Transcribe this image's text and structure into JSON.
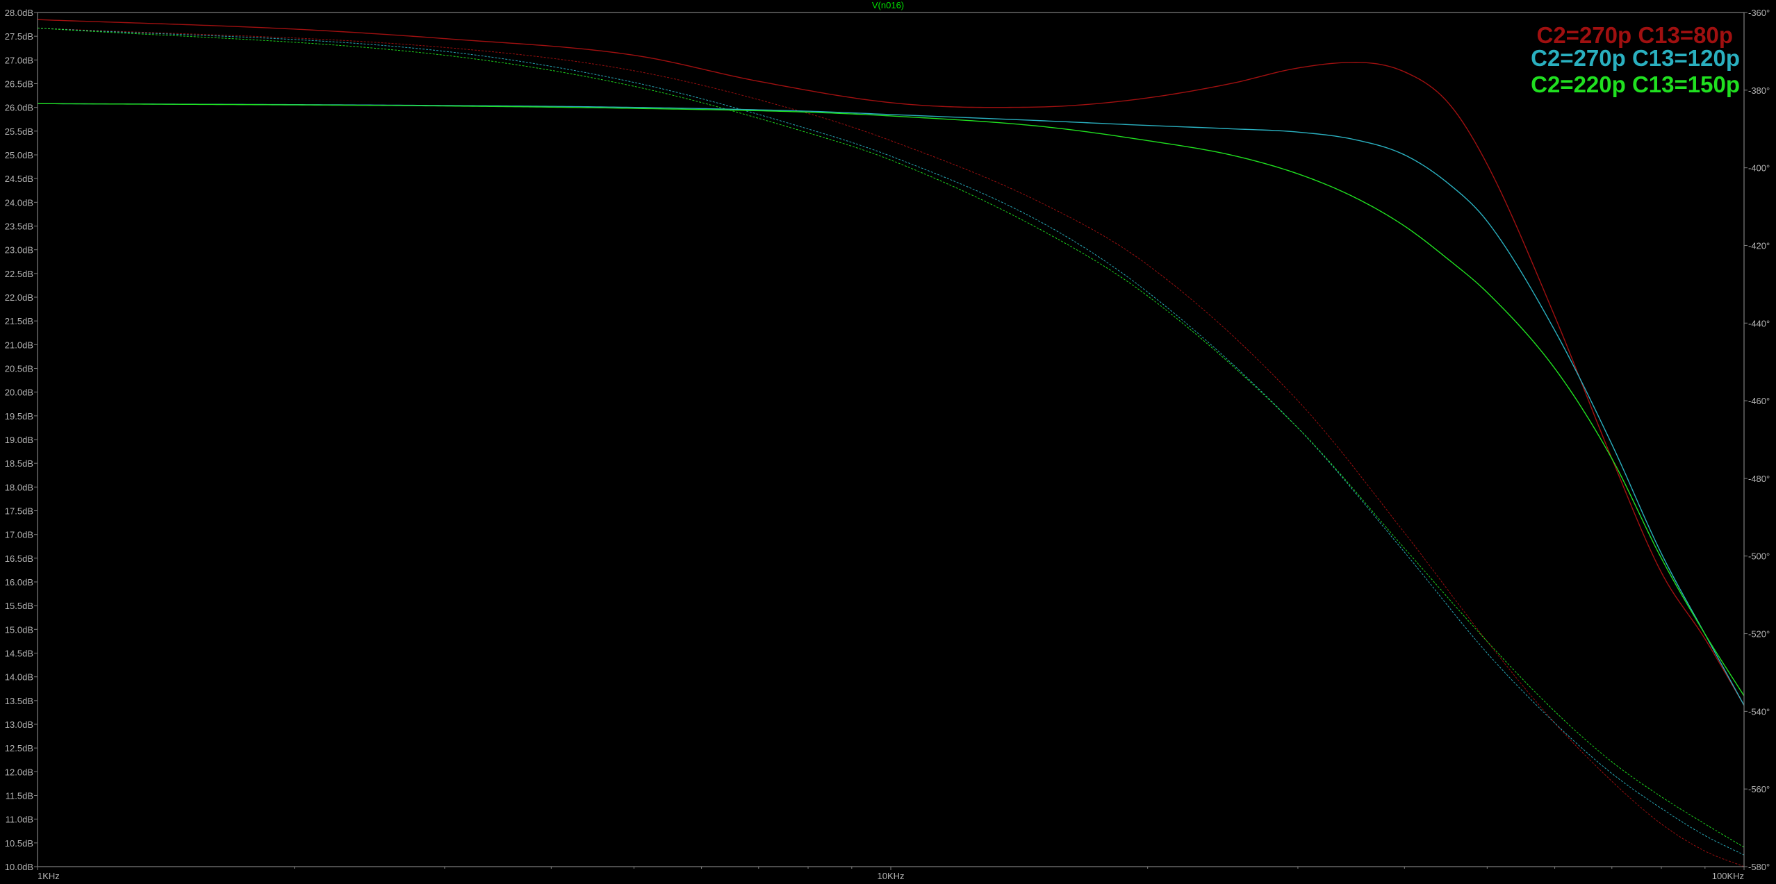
{
  "chart_data": {
    "type": "line",
    "title": "V(n016)",
    "title_color": "#00e000",
    "background_color": "#000000",
    "axis_color": "#808080",
    "tick_label_color": "#b4b4b4",
    "grid": false,
    "x_scale": "log",
    "xlim": [
      1000,
      100000
    ],
    "x_ticks": [
      {
        "value": 1000,
        "label": "1KHz"
      },
      {
        "value": 10000,
        "label": "10KHz"
      },
      {
        "value": 100000,
        "label": "100KHz"
      }
    ],
    "ylim": [
      10,
      28
    ],
    "y_ticks": [
      {
        "value": 28.0,
        "label": "28.0dB"
      },
      {
        "value": 27.5,
        "label": "27.5dB"
      },
      {
        "value": 27.0,
        "label": "27.0dB"
      },
      {
        "value": 26.5,
        "label": "26.5dB"
      },
      {
        "value": 26.0,
        "label": "26.0dB"
      },
      {
        "value": 25.5,
        "label": "25.5dB"
      },
      {
        "value": 25.0,
        "label": "25.0dB"
      },
      {
        "value": 24.5,
        "label": "24.5dB"
      },
      {
        "value": 24.0,
        "label": "24.0dB"
      },
      {
        "value": 23.5,
        "label": "23.5dB"
      },
      {
        "value": 23.0,
        "label": "23.0dB"
      },
      {
        "value": 22.5,
        "label": "22.5dB"
      },
      {
        "value": 22.0,
        "label": "22.0dB"
      },
      {
        "value": 21.5,
        "label": "21.5dB"
      },
      {
        "value": 21.0,
        "label": "21.0dB"
      },
      {
        "value": 20.5,
        "label": "20.5dB"
      },
      {
        "value": 20.0,
        "label": "20.0dB"
      },
      {
        "value": 19.5,
        "label": "19.5dB"
      },
      {
        "value": 19.0,
        "label": "19.0dB"
      },
      {
        "value": 18.5,
        "label": "18.5dB"
      },
      {
        "value": 18.0,
        "label": "18.0dB"
      },
      {
        "value": 17.5,
        "label": "17.5dB"
      },
      {
        "value": 17.0,
        "label": "17.0dB"
      },
      {
        "value": 16.5,
        "label": "16.5dB"
      },
      {
        "value": 16.0,
        "label": "16.0dB"
      },
      {
        "value": 15.5,
        "label": "15.5dB"
      },
      {
        "value": 15.0,
        "label": "15.0dB"
      },
      {
        "value": 14.5,
        "label": "14.5dB"
      },
      {
        "value": 14.0,
        "label": "14.0dB"
      },
      {
        "value": 13.5,
        "label": "13.5dB"
      },
      {
        "value": 13.0,
        "label": "13.0dB"
      },
      {
        "value": 12.5,
        "label": "12.5dB"
      },
      {
        "value": 12.0,
        "label": "12.0dB"
      },
      {
        "value": 11.5,
        "label": "11.5dB"
      },
      {
        "value": 11.0,
        "label": "11.0dB"
      },
      {
        "value": 10.5,
        "label": "10.5dB"
      },
      {
        "value": 10.0,
        "label": "10.0dB"
      }
    ],
    "y2lim": [
      -360,
      -580
    ],
    "y2_ticks": [
      {
        "value": -360,
        "label": "-360°"
      },
      {
        "value": -380,
        "label": "-380°"
      },
      {
        "value": -400,
        "label": "-400°"
      },
      {
        "value": -420,
        "label": "-420°"
      },
      {
        "value": -440,
        "label": "-440°"
      },
      {
        "value": -460,
        "label": "-460°"
      },
      {
        "value": -480,
        "label": "-480°"
      },
      {
        "value": -500,
        "label": "-500°"
      },
      {
        "value": -520,
        "label": "-520°"
      },
      {
        "value": -540,
        "label": "-540°"
      },
      {
        "value": -560,
        "label": "-560°"
      },
      {
        "value": -580,
        "label": "-580°"
      }
    ],
    "legend_placement": "top-right",
    "series": [
      {
        "name": "C2=270p C13=80p",
        "color": "#a01010",
        "magnitude": {
          "x": [
            1000,
            2000,
            3000,
            5000,
            7000,
            10000,
            13000,
            16000,
            20000,
            25000,
            30000,
            35000,
            40000,
            45000,
            50000,
            60000,
            70000,
            80000,
            90000,
            100000
          ],
          "y": [
            27.85,
            27.65,
            27.45,
            27.1,
            26.55,
            26.1,
            26.0,
            26.03,
            26.2,
            26.5,
            26.83,
            26.95,
            26.75,
            26.1,
            24.8,
            21.6,
            18.6,
            16.2,
            14.8,
            13.4
          ]
        },
        "phase": {
          "x": [
            1000,
            3000,
            5000,
            8000,
            10000,
            15000,
            20000,
            30000,
            40000,
            50000,
            60000,
            70000,
            80000,
            90000,
            100000
          ],
          "y": [
            -364,
            -369,
            -375,
            -386,
            -393,
            -409,
            -425,
            -460,
            -494,
            -522,
            -543,
            -558,
            -569,
            -576,
            -580
          ]
        }
      },
      {
        "name": "C2=270p C13=120p",
        "color": "#2ab0c0",
        "magnitude": {
          "x": [
            1000,
            3000,
            5000,
            8000,
            10000,
            15000,
            20000,
            25000,
            30000,
            35000,
            40000,
            45000,
            50000,
            60000,
            70000,
            80000,
            90000,
            100000
          ],
          "y": [
            26.08,
            26.04,
            26.0,
            25.92,
            25.85,
            25.72,
            25.62,
            25.55,
            25.48,
            25.32,
            25.0,
            24.4,
            23.6,
            21.3,
            18.9,
            16.6,
            14.9,
            13.4
          ]
        },
        "phase": {
          "x": [
            1000,
            3000,
            5000,
            8000,
            10000,
            15000,
            20000,
            30000,
            40000,
            50000,
            60000,
            70000,
            80000,
            90000,
            100000
          ],
          "y": [
            -364,
            -370,
            -378,
            -390,
            -397,
            -414,
            -432,
            -467,
            -499,
            -525,
            -543,
            -556,
            -565,
            -572,
            -577
          ]
        }
      },
      {
        "name": "C2=220p C13=150p",
        "color": "#20e020",
        "magnitude": {
          "x": [
            1000,
            3000,
            5000,
            8000,
            10000,
            15000,
            20000,
            25000,
            30000,
            35000,
            40000,
            45000,
            50000,
            60000,
            70000,
            80000,
            90000,
            100000
          ],
          "y": [
            26.08,
            26.03,
            25.98,
            25.9,
            25.82,
            25.6,
            25.3,
            25.0,
            24.6,
            24.1,
            23.5,
            22.8,
            22.1,
            20.5,
            18.6,
            16.5,
            14.9,
            13.6
          ]
        },
        "phase": {
          "x": [
            1000,
            3000,
            5000,
            8000,
            10000,
            15000,
            20000,
            30000,
            40000,
            50000,
            60000,
            70000,
            80000,
            90000,
            100000
          ],
          "y": [
            -364,
            -371,
            -379,
            -391,
            -398,
            -416,
            -433,
            -467,
            -498,
            -522,
            -540,
            -553,
            -562,
            -569,
            -575
          ]
        }
      }
    ]
  }
}
